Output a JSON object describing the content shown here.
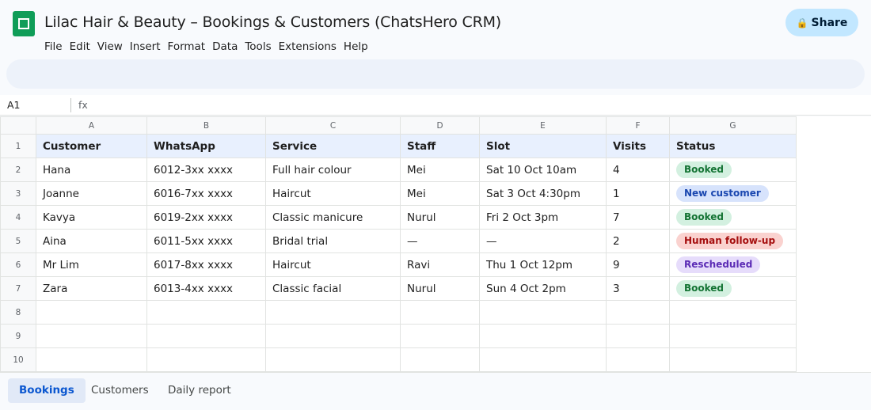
{
  "app": {
    "title": "Lilac Hair & Beauty – Bookings & Customers (ChatsHero CRM)",
    "logo_icon": "sheets-logo-icon",
    "share_label": "Share",
    "share_icon": "lock-icon"
  },
  "menu": [
    "File",
    "Edit",
    "View",
    "Insert",
    "Format",
    "Data",
    "Tools",
    "Extensions",
    "Help"
  ],
  "formula_bar": {
    "cell_ref": "A1",
    "fx": "fx"
  },
  "grid": {
    "column_letters": [
      "A",
      "B",
      "C",
      "D",
      "E",
      "F",
      "G"
    ],
    "row_numbers": [
      "1",
      "2",
      "3",
      "4",
      "5",
      "6",
      "7",
      "8",
      "9",
      "10"
    ],
    "headers": [
      "Customer",
      "WhatsApp",
      "Service",
      "Staff",
      "Slot",
      "Visits",
      "Status"
    ],
    "rows": [
      {
        "customer": "Hana",
        "whatsapp": "6012-3xx xxxx",
        "service": "Full hair colour",
        "staff": "Mei",
        "slot": "Sat 10 Oct 10am",
        "visits": "4",
        "status": "Booked",
        "status_kind": "booked"
      },
      {
        "customer": "Joanne",
        "whatsapp": "6016-7xx xxxx",
        "service": "Haircut",
        "staff": "Mei",
        "slot": "Sat 3 Oct 4:30pm",
        "visits": "1",
        "status": "New customer",
        "status_kind": "new"
      },
      {
        "customer": "Kavya",
        "whatsapp": "6019-2xx xxxx",
        "service": "Classic manicure",
        "staff": "Nurul",
        "slot": "Fri 2 Oct 3pm",
        "visits": "7",
        "status": "Booked",
        "status_kind": "booked"
      },
      {
        "customer": "Aina",
        "whatsapp": "6011-5xx xxxx",
        "service": "Bridal trial",
        "staff": "—",
        "slot": "—",
        "visits": "2",
        "status": "Human follow-up",
        "status_kind": "human"
      },
      {
        "customer": "Mr Lim",
        "whatsapp": "6017-8xx xxxx",
        "service": "Haircut",
        "staff": "Ravi",
        "slot": "Thu 1 Oct 12pm",
        "visits": "9",
        "status": "Rescheduled",
        "status_kind": "resched"
      },
      {
        "customer": "Zara",
        "whatsapp": "6013-4xx xxxx",
        "service": "Classic facial",
        "staff": "Nurul",
        "slot": "Sun 4 Oct 2pm",
        "visits": "3",
        "status": "Booked",
        "status_kind": "booked"
      }
    ]
  },
  "status_colors": {
    "booked": {
      "bg": "#d3f0e0",
      "fg": "#137333"
    },
    "new": {
      "bg": "#d7e3fc",
      "fg": "#1a47b0"
    },
    "human": {
      "bg": "#fad2cf",
      "fg": "#a50e0e"
    },
    "resched": {
      "bg": "#e6dcfb",
      "fg": "#5b2bb5"
    }
  },
  "sheet_tabs": [
    {
      "label": "Bookings",
      "active": true
    },
    {
      "label": "Customers",
      "active": false
    },
    {
      "label": "Daily report",
      "active": false
    }
  ]
}
